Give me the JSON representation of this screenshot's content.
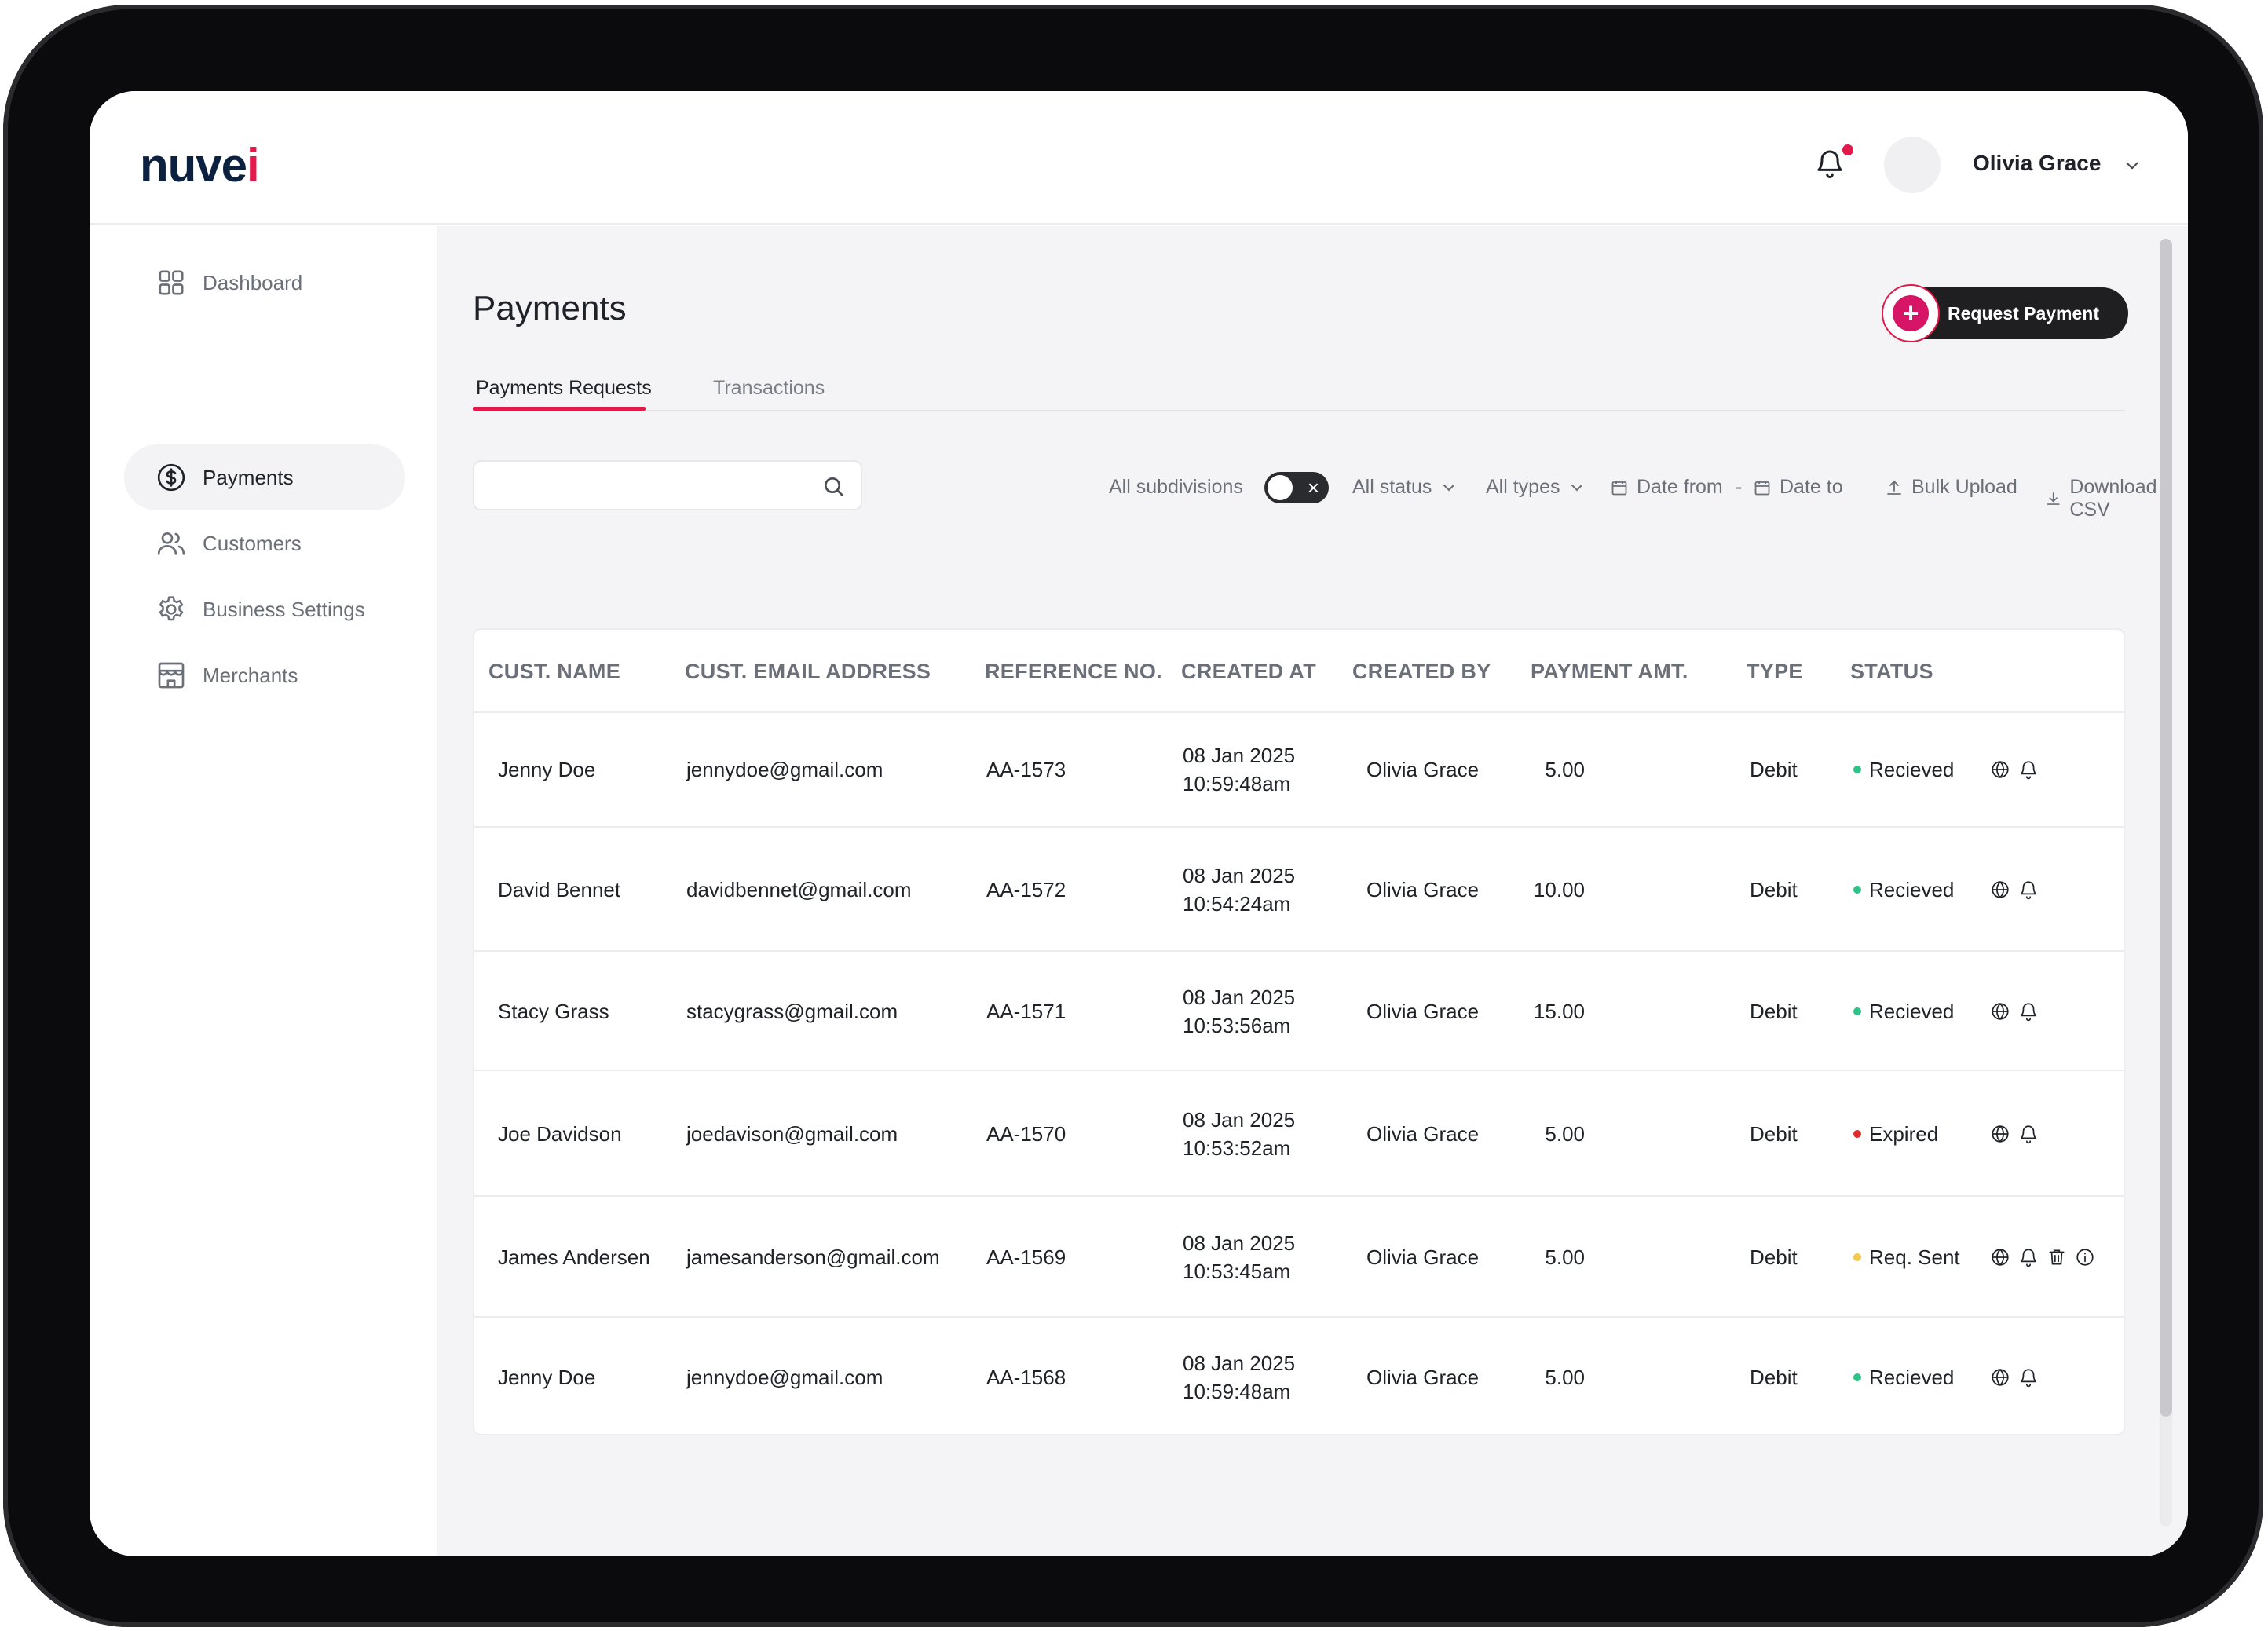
{
  "app": {
    "logo_text": "nuve",
    "logo_accent": "i",
    "brand_color": "#e3194b"
  },
  "header": {
    "user_name": "Olivia Grace"
  },
  "sidebar": {
    "items": [
      {
        "label": "Dashboard",
        "icon": "grid-icon",
        "active": false
      },
      {
        "label": "Payments",
        "icon": "dollar-circle-icon",
        "active": true
      },
      {
        "label": "Customers",
        "icon": "users-icon",
        "active": false
      },
      {
        "label": "Business Settings",
        "icon": "gear-icon",
        "active": false
      },
      {
        "label": "Merchants",
        "icon": "store-icon",
        "active": false
      }
    ]
  },
  "page": {
    "title": "Payments",
    "request_button": "Request Payment",
    "tabs": [
      {
        "label": "Payments Requests",
        "active": true
      },
      {
        "label": "Transactions",
        "active": false
      }
    ]
  },
  "filters": {
    "search_placeholder": "",
    "subdivisions_label": "All subdivisions",
    "status_label": "All status",
    "types_label": "All types",
    "date_from": "Date from",
    "date_separator": "-",
    "date_to": "Date to",
    "bulk_upload": "Bulk Upload",
    "download_csv": "Download CSV"
  },
  "table": {
    "columns": [
      "CUST. NAME",
      "CUST. EMAIL ADDRESS",
      "REFERENCE NO.",
      "CREATED AT",
      "CREATED BY",
      "PAYMENT AMT.",
      "TYPE",
      "STATUS"
    ],
    "rows": [
      {
        "name": "Jenny Doe",
        "email": "jennydoe@gmail.com",
        "ref": "AA-1573",
        "date": "08 Jan 2025",
        "time": "10:59:48am",
        "created_by": "Olivia Grace",
        "amount": "5.00",
        "type": "Debit",
        "status": "Recieved",
        "status_color": "#2fc38a",
        "actions": [
          "globe-icon",
          "bell-icon"
        ]
      },
      {
        "name": "David Bennet",
        "email": "davidbennet@gmail.com",
        "ref": "AA-1572",
        "date": "08 Jan 2025",
        "time": "10:54:24am",
        "created_by": "Olivia Grace",
        "amount": "10.00",
        "type": "Debit",
        "status": "Recieved",
        "status_color": "#2fc38a",
        "actions": [
          "globe-icon",
          "bell-icon"
        ]
      },
      {
        "name": "Stacy Grass",
        "email": "stacygrass@gmail.com",
        "ref": "AA-1571",
        "date": "08 Jan 2025",
        "time": "10:53:56am",
        "created_by": "Olivia Grace",
        "amount": "15.00",
        "type": "Debit",
        "status": "Recieved",
        "status_color": "#2fc38a",
        "actions": [
          "globe-icon",
          "bell-icon"
        ]
      },
      {
        "name": "Joe Davidson",
        "email": "joedavison@gmail.com",
        "ref": "AA-1570",
        "date": "08 Jan 2025",
        "time": "10:53:52am",
        "created_by": "Olivia Grace",
        "amount": "5.00",
        "type": "Debit",
        "status": "Expired",
        "status_color": "#e32b2b",
        "actions": [
          "globe-icon",
          "bell-icon"
        ]
      },
      {
        "name": "James Andersen",
        "email": "jamesanderson@gmail.com",
        "ref": "AA-1569",
        "date": "08 Jan 2025",
        "time": "10:53:45am",
        "created_by": "Olivia Grace",
        "amount": "5.00",
        "type": "Debit",
        "status": "Req. Sent",
        "status_color": "#f2c94c",
        "actions": [
          "globe-icon",
          "bell-icon",
          "trash-icon",
          "info-icon"
        ]
      },
      {
        "name": "Jenny Doe",
        "email": "jennydoe@gmail.com",
        "ref": "AA-1568",
        "date": "08 Jan 2025",
        "time": "10:59:48am",
        "created_by": "Olivia Grace",
        "amount": "5.00",
        "type": "Debit",
        "status": "Recieved",
        "status_color": "#2fc38a",
        "actions": [
          "globe-icon",
          "bell-icon"
        ]
      }
    ]
  }
}
